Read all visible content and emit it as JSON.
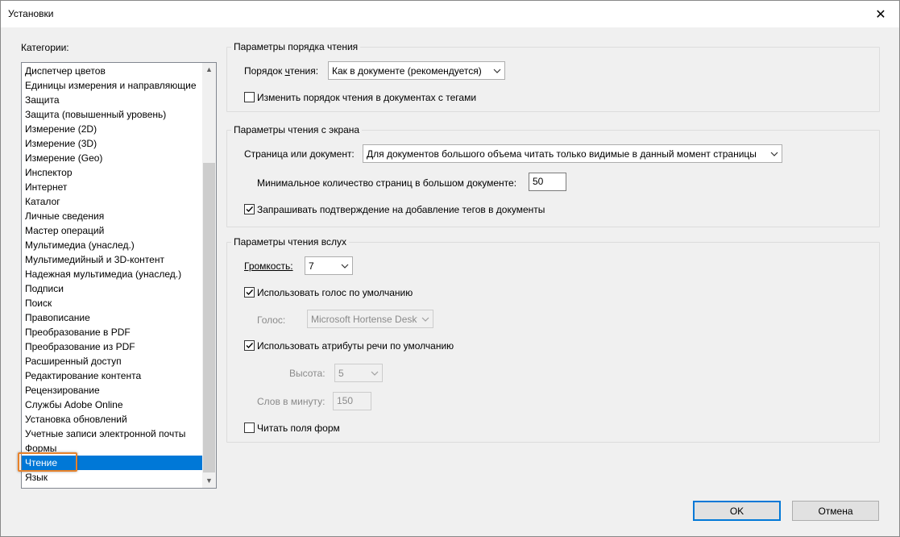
{
  "window": {
    "title": "Установки",
    "close_glyph": "✕"
  },
  "categories": {
    "label": "Категории:",
    "items": [
      "Диспетчер цветов",
      "Единицы измерения и направляющие",
      "Защита",
      "Защита (повышенный уровень)",
      "Измерение (2D)",
      "Измерение (3D)",
      "Измерение (Geo)",
      "Инспектор",
      "Интернет",
      "Каталог",
      "Личные сведения",
      "Мастер операций",
      "Мультимедиа (унаслед.)",
      "Мультимедийный и 3D-контент",
      "Надежная мультимедиа (унаслед.)",
      "Подписи",
      "Поиск",
      "Правописание",
      "Преобразование в PDF",
      "Преобразование из PDF",
      "Расширенный доступ",
      "Редактирование контента",
      "Рецензирование",
      "Службы Adobe Online",
      "Установка обновлений",
      "Учетные записи электронной почты",
      "Формы",
      "Чтение",
      "Язык"
    ],
    "selected": "Чтение",
    "scroll_up_icon": "▲",
    "scroll_down_icon": "▼"
  },
  "reading_order": {
    "title": "Параметры порядка чтения",
    "order_label_pre": "Порядок ",
    "order_label_u": "ч",
    "order_label_post": "тения:",
    "order_value": "Как в документе (рекомендуется)",
    "override_label": "Изменить порядок чтения в документах с тегами",
    "override_checked": false
  },
  "screen_reader": {
    "title": "Параметры чтения с экрана",
    "page_doc_label": "Страница или документ:",
    "page_doc_value": "Для документов большого объема читать только видимые в данный момент страницы",
    "min_pages_label": "Минимальное количество страниц в большом документе:",
    "min_pages_value": "50",
    "confirm_tags_label": "Запрашивать подтверждение на добавление тегов в документы",
    "confirm_tags_checked": true
  },
  "read_aloud": {
    "title": "Параметры чтения вслух",
    "volume_label": "Громкость:",
    "volume_value": "7",
    "default_voice_label": "Использовать голос по умолчанию",
    "default_voice_checked": true,
    "voice_label": "Голос:",
    "voice_value": "Microsoft Hortense Deskt",
    "default_speech_label": "Использовать атрибуты речи по умолчанию",
    "default_speech_checked": true,
    "pitch_label": "Высота:",
    "pitch_value": "5",
    "wpm_label": "Слов в минуту:",
    "wpm_value": "150",
    "read_forms_label": "Читать поля форм",
    "read_forms_checked": false
  },
  "buttons": {
    "ok": "OK",
    "cancel": "Отмена"
  },
  "colors": {
    "selection": "#0078d7",
    "highlight_box": "#e8822a"
  }
}
